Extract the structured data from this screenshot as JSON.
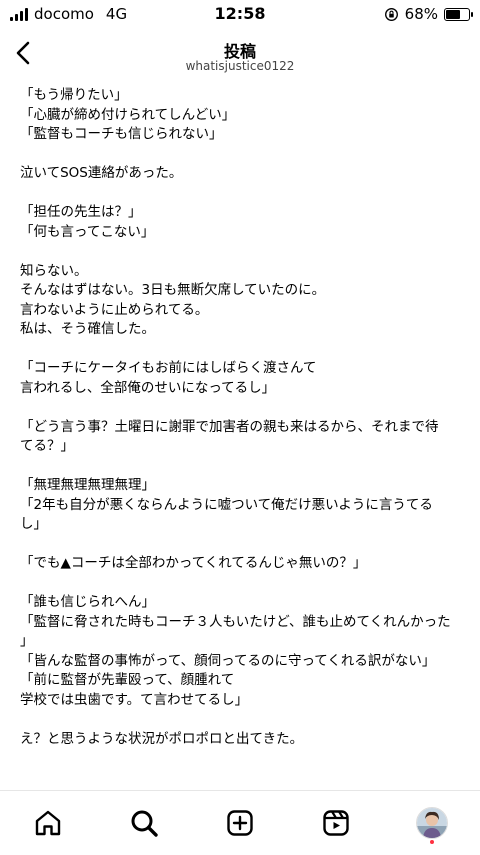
{
  "status_bar": {
    "carrier": "docomo",
    "network": "4G",
    "time": "12:58",
    "battery_percent": "68%",
    "battery_level": 0.68
  },
  "header": {
    "title": "投稿",
    "username": "whatisjustice0122"
  },
  "post": {
    "lines": [
      "「もう帰りたい」",
      "「心臓が締め付けられてしんどい」",
      "「監督もコーチも信じられない」",
      "",
      "泣いてSOS連絡があった。",
      "",
      "「担任の先生は？」",
      "「何も言ってこない」",
      "",
      "知らない。",
      "そんなはずはない。3日も無断欠席していたのに。",
      "言わないように止められてる。",
      "私は、そう確信した。",
      "",
      "「コーチにケータイもお前にはしばらく渡さんて",
      "言われるし、全部俺のせいになってるし」",
      "",
      "「どう言う事？土曜日に謝罪で加害者の親も来はるから、それまで待",
      "てる？」",
      "",
      "「無理無理無理無理」",
      "「2年も自分が悪くならんように嘘ついて俺だけ悪いように言うてる",
      "し」",
      "",
      "「でも▲コーチは全部わかってくれてるんじゃ無いの？」",
      "",
      "「誰も信じられへん」",
      "「監督に脅された時もコーチ３人もいたけど、誰も止めてくれんかった",
      "」",
      "「皆んな監督の事怖がって、顔伺ってるのに守ってくれる訳がない」",
      "「前に監督が先輩殴って、顔腫れて",
      "学校では虫歯です。て言わせてるし」",
      "",
      "え？と思うような状況がポロポロと出てきた。"
    ]
  },
  "tab_bar": {
    "items": [
      {
        "name": "home-tab",
        "icon": "home-icon"
      },
      {
        "name": "search-tab",
        "icon": "search-icon"
      },
      {
        "name": "create-tab",
        "icon": "plus-square-icon"
      },
      {
        "name": "reels-tab",
        "icon": "reels-icon"
      },
      {
        "name": "profile-tab",
        "icon": "avatar"
      }
    ]
  }
}
